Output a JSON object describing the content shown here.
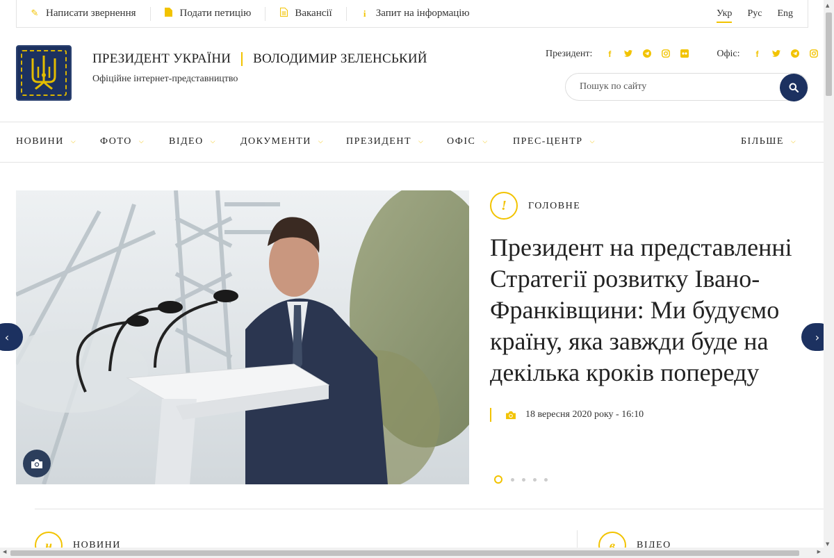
{
  "topbar": {
    "links": [
      {
        "label": "Написати звернення",
        "icon": "pencil-icon"
      },
      {
        "label": "Подати петицію",
        "icon": "file-icon"
      },
      {
        "label": "Вакансії",
        "icon": "document-icon"
      },
      {
        "label": "Запит на інформацію",
        "icon": "info-icon"
      }
    ],
    "languages": [
      {
        "label": "Укр",
        "active": true
      },
      {
        "label": "Рус",
        "active": false
      },
      {
        "label": "Eng",
        "active": false
      }
    ]
  },
  "header": {
    "title_left": "ПРЕЗИДЕНТ УКРАЇНИ",
    "title_right": "ВОЛОДИМИР ЗЕЛЕНСЬКИЙ",
    "subtitle": "Офіційне інтернет-представництво",
    "socials_president_label": "Президент:",
    "socials_office_label": "Офіс:",
    "search_placeholder": "Пошук по сайту"
  },
  "nav": {
    "items": [
      "НОВИНИ",
      "ФОТО",
      "ВІДЕО",
      "ДОКУМЕНТИ",
      "ПРЕЗИДЕНТ",
      "ОФІС",
      "ПРЕС-ЦЕНТР"
    ],
    "more": "БІЛЬШЕ"
  },
  "hero": {
    "category_symbol": "!",
    "category": "ГОЛОВНЕ",
    "headline": "Президент на представленні Стратегії розвитку Івано-Франківщини: Ми будуємо країну, яка завжди буде на декілька кроків попереду",
    "date": "18 вересня 2020 року - 16:10",
    "slides_total": 5,
    "active_slide": 1
  },
  "sections": {
    "news_symbol": "н",
    "news_label": "НОВИНИ",
    "video_symbol": "в",
    "video_label": "ВІДЕО"
  },
  "colors": {
    "accent": "#f2c300",
    "navy": "#1c3160"
  }
}
